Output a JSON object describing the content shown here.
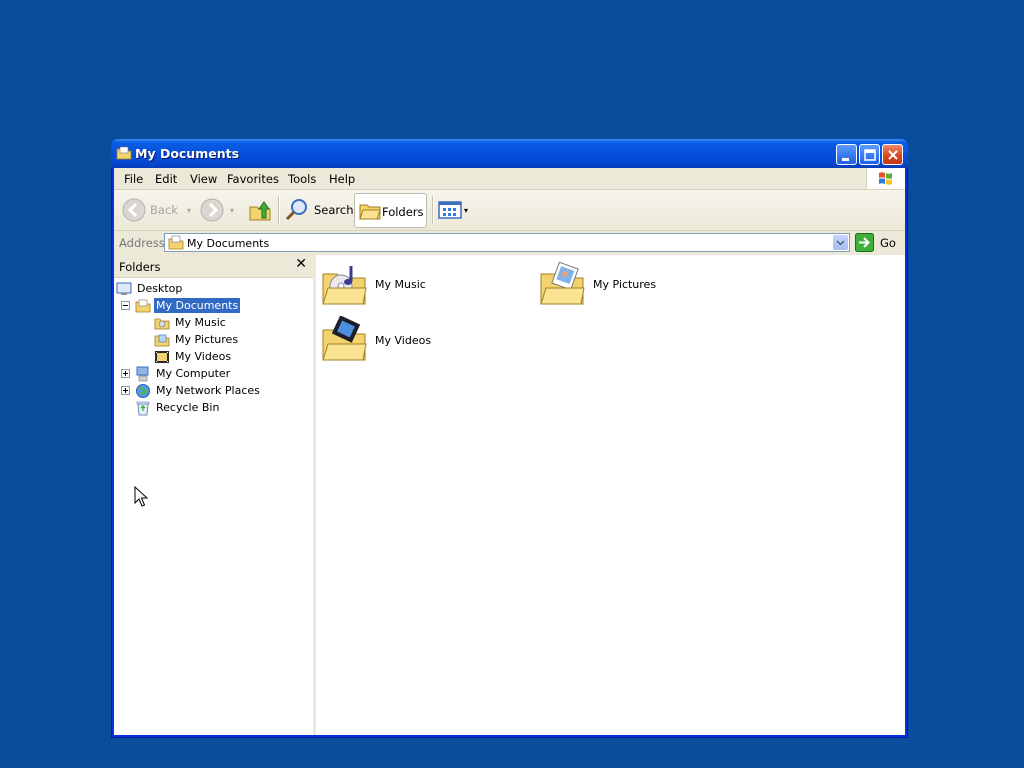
{
  "window": {
    "title": "My Documents",
    "buttons": {
      "minimize": "minimize",
      "maximize": "maximize",
      "close": "close"
    }
  },
  "menu": [
    "File",
    "Edit",
    "View",
    "Favorites",
    "Tools",
    "Help"
  ],
  "toolbar": {
    "back_label": "Back",
    "search_label": "Search",
    "folders_label": "Folders"
  },
  "address": {
    "label": "Address",
    "value": "My Documents",
    "go_label": "Go"
  },
  "folders_pane": {
    "title": "Folders",
    "close_glyph": "✕",
    "tree": [
      {
        "label": "Desktop",
        "icon": "desktop-icon"
      },
      {
        "label": "My Documents",
        "icon": "my-documents-icon",
        "selected": true,
        "expander": "minus"
      },
      {
        "label": "My Music",
        "icon": "music-folder-icon"
      },
      {
        "label": "My Pictures",
        "icon": "pictures-folder-icon"
      },
      {
        "label": "My Videos",
        "icon": "videos-folder-icon"
      },
      {
        "label": "My Computer",
        "icon": "computer-icon",
        "expander": "plus"
      },
      {
        "label": "My Network Places",
        "icon": "network-places-icon",
        "expander": "plus"
      },
      {
        "label": "Recycle Bin",
        "icon": "recycle-bin-icon"
      }
    ]
  },
  "content": {
    "items": [
      {
        "label": "My Music",
        "icon": "music-folder-icon"
      },
      {
        "label": "My Pictures",
        "icon": "pictures-folder-icon"
      },
      {
        "label": "My Videos",
        "icon": "videos-folder-icon"
      }
    ]
  },
  "colors": {
    "desktop": "#0a4d9c",
    "titlebar": "#0752de",
    "selection": "#316ac5",
    "chrome": "#ece9d8"
  }
}
